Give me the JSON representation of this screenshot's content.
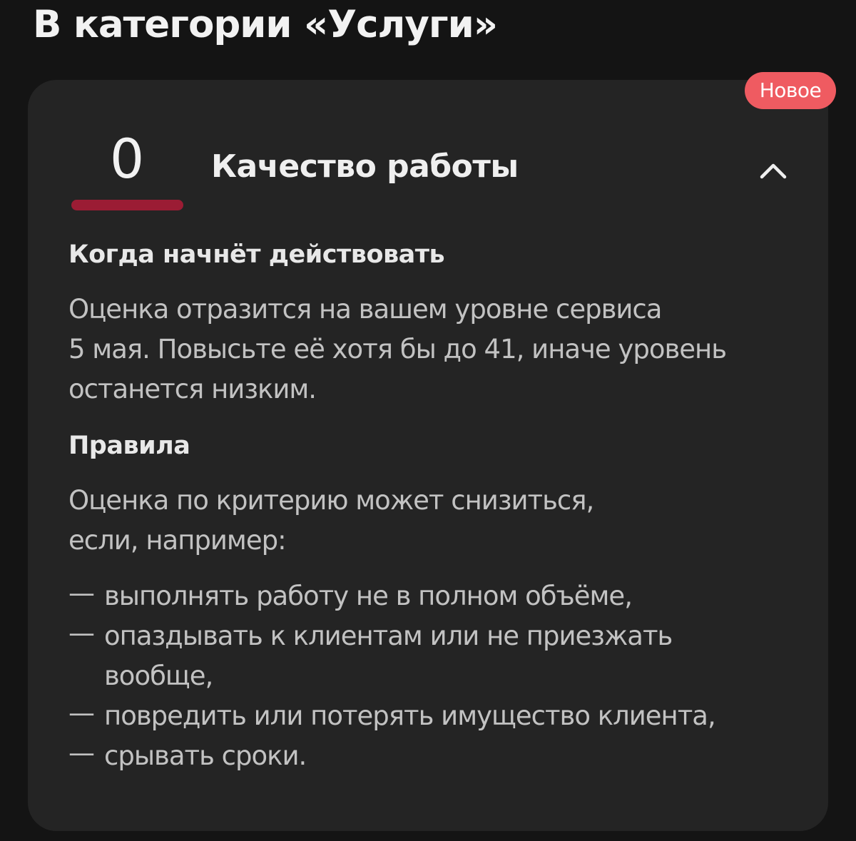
{
  "section": {
    "heading": "В категории «Услуги»"
  },
  "card": {
    "badge": "Новое",
    "score": "0",
    "title": "Качество работы",
    "toggle_icon": "chevron-up-icon",
    "colors": {
      "background": "#242424",
      "badge": "#ef5b61",
      "score_bar": "#9b1c34"
    },
    "when": {
      "heading": "Когда начнёт действовать",
      "lines": [
        "Оценка отразится на вашем уровне сервиса",
        "5 мая. Повысьте её хотя бы до 41, иначе уровень",
        "останется низким."
      ]
    },
    "rules": {
      "heading": "Правила",
      "intro_lines": [
        "Оценка по критерию может снизиться,",
        "если, например:"
      ],
      "dash": "—",
      "items": [
        [
          "выполнять работу не в полном объёме,"
        ],
        [
          "опаздывать к клиентам или не приезжать",
          "вообще,"
        ],
        [
          "повредить или потерять имущество клиента,"
        ],
        [
          "срывать сроки."
        ]
      ]
    }
  }
}
